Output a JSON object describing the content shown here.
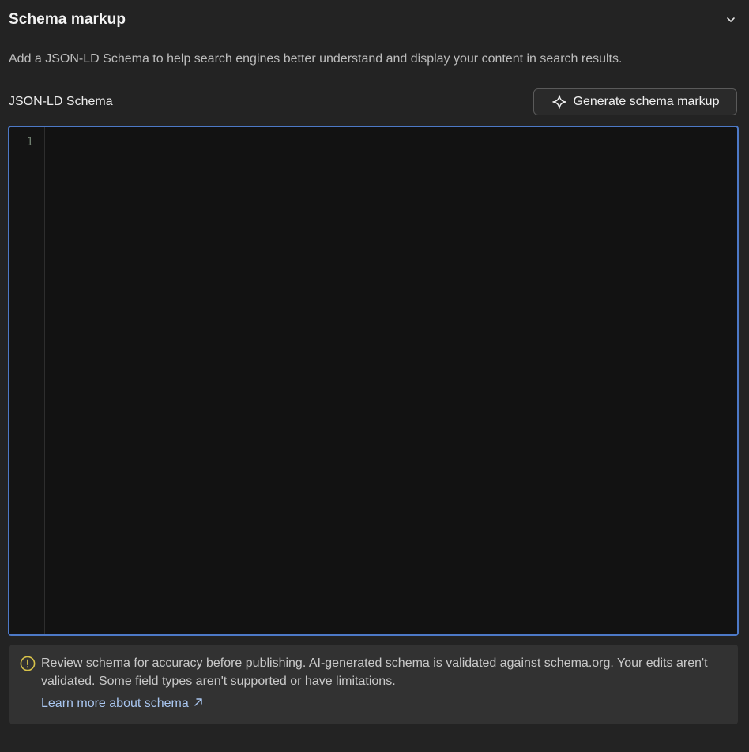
{
  "header": {
    "title": "Schema markup",
    "chevron_icon": "chevron-down-icon"
  },
  "description": "Add a JSON-LD Schema to help search engines better understand and display your content in search results.",
  "schema_field": {
    "label": "JSON-LD Schema",
    "generate_button": {
      "label": "Generate schema markup",
      "icon": "sparkle-icon"
    }
  },
  "editor": {
    "line_numbers": [
      "1"
    ],
    "content": "",
    "focus_border_color": "#4d79c7"
  },
  "notice": {
    "icon": "warning-icon",
    "icon_color": "#d8c34a",
    "text": "Review schema for accuracy before publishing. AI-generated schema is validated against schema.org. Your edits aren't validated. Some field types aren't supported or have limitations.",
    "link_label": "Learn more about schema",
    "link_icon": "external-arrow-icon",
    "link_color": "#a9c6f0"
  }
}
